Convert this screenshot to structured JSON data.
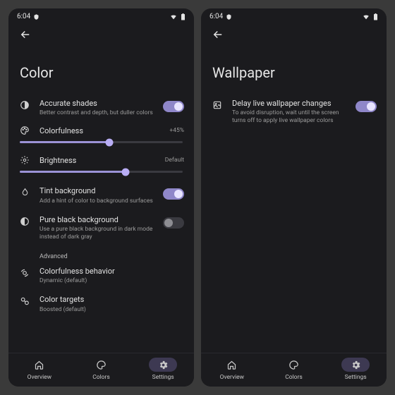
{
  "statusbar": {
    "time": "6:04"
  },
  "left": {
    "title": "Color",
    "accurate": {
      "title": "Accurate shades",
      "sub": "Better contrast and depth, but duller colors",
      "on": true
    },
    "colorfulness": {
      "title": "Colorfulness",
      "value": "+45%",
      "percent": 55
    },
    "brightness": {
      "title": "Brightness",
      "value": "Default",
      "percent": 65
    },
    "tint": {
      "title": "Tint background",
      "sub": "Add a hint of color to background surfaces",
      "on": true
    },
    "pureblack": {
      "title": "Pure black background",
      "sub": "Use a pure black background in dark mode instead of dark gray",
      "on": false
    },
    "advanced_label": "Advanced",
    "colorfulness_behavior": {
      "title": "Colorfulness behavior",
      "sub": "Dynamic (default)"
    },
    "color_targets": {
      "title": "Color targets",
      "sub": "Boosted (default)"
    }
  },
  "right": {
    "title": "Wallpaper",
    "delay": {
      "title": "Delay live wallpaper changes",
      "sub": "To avoid disruption, wait until the screen turns off to apply live wallpaper colors",
      "on": true
    }
  },
  "bottomnav": {
    "overview": "Overview",
    "colors": "Colors",
    "settings": "Settings"
  }
}
